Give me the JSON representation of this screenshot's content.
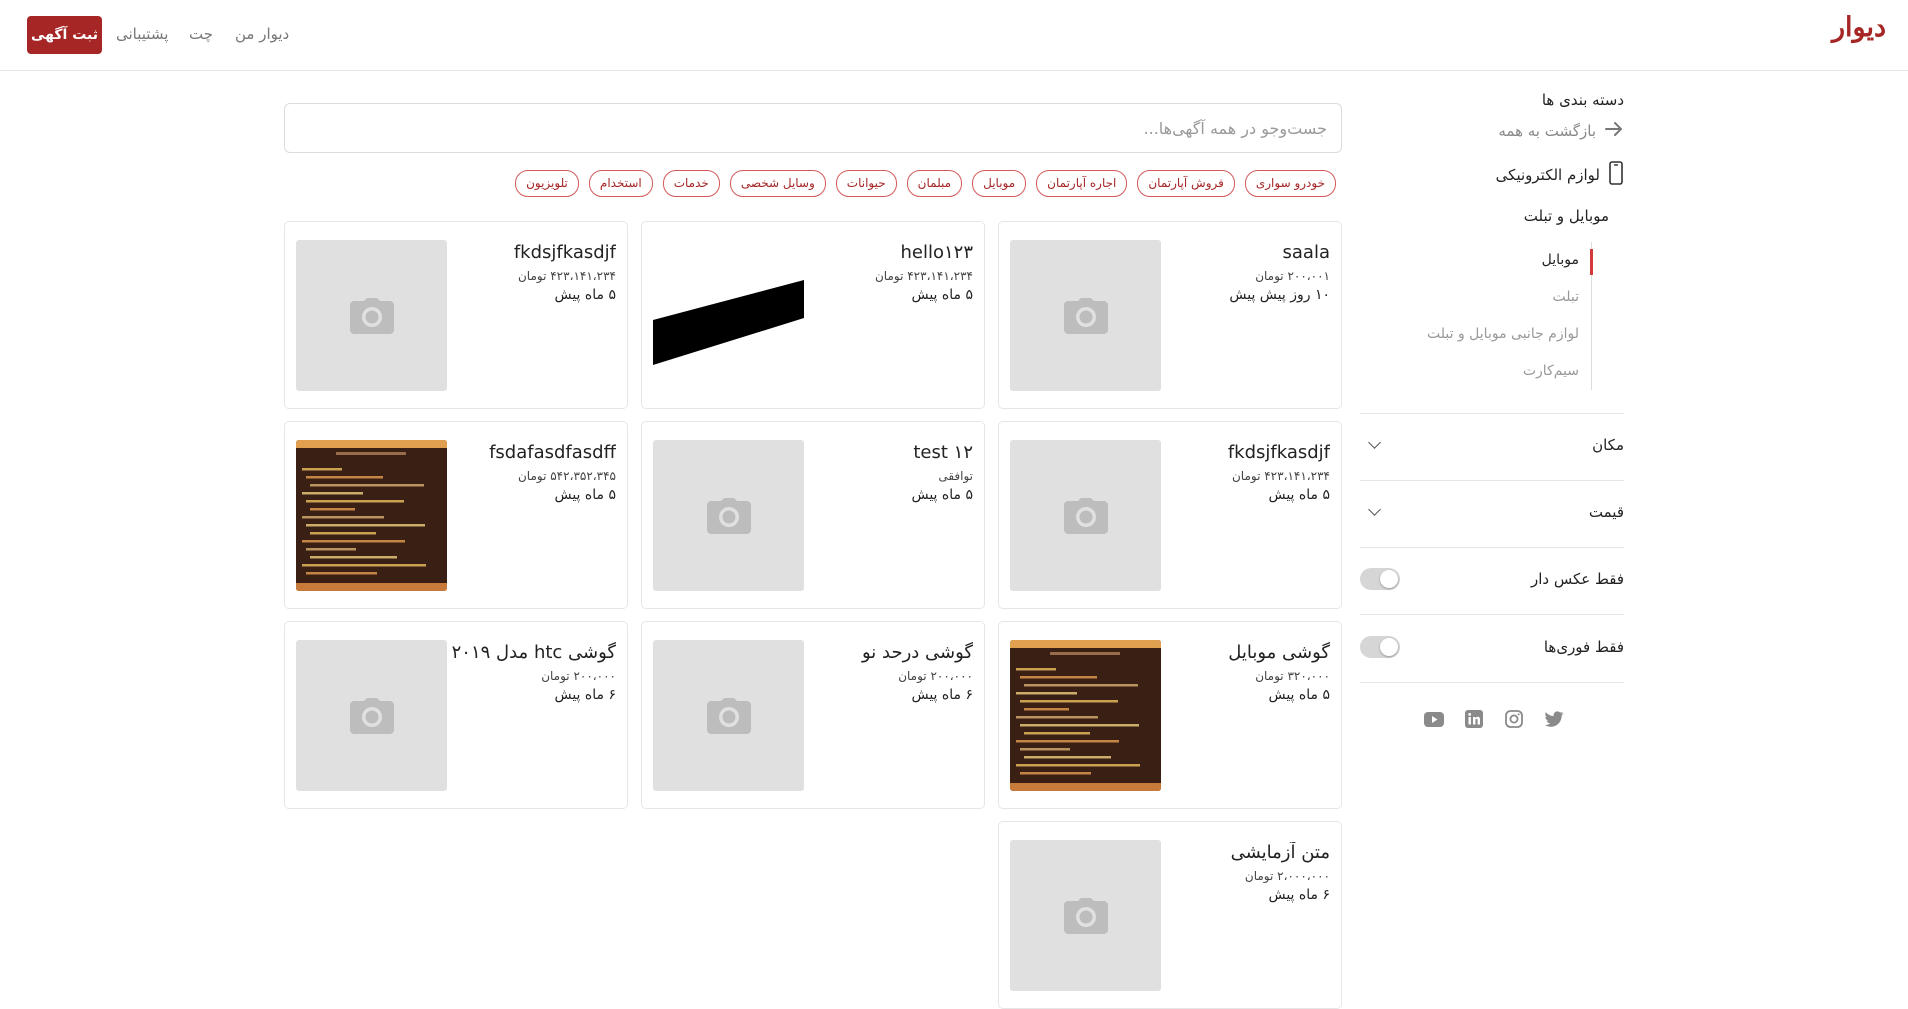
{
  "header": {
    "logo": "دیوار",
    "post_ad": "ثبت آگهی",
    "nav": {
      "my_divar": "دیوار من",
      "chat": "چت",
      "support": "پشتیبانی"
    }
  },
  "sidebar": {
    "categories_title": "دسته بندی ها",
    "back_to_all": "بازگشت به همه",
    "category": "لوازم الکترونیکی",
    "subcategory": "موبایل و تبلت",
    "sub_items": [
      {
        "label": "موبایل",
        "active": true
      },
      {
        "label": "تبلت",
        "active": false
      },
      {
        "label": "لوازم جانبی موبایل و تبلت",
        "active": false
      },
      {
        "label": "سیم‌کارت",
        "active": false
      }
    ],
    "location": "مکان",
    "price": "قیمت",
    "photo_only": "فقط عکس دار",
    "urgent_only": "فقط فوری‌ها",
    "social_icons": [
      "twitter-icon",
      "instagram-icon",
      "linkedin-icon",
      "youtube-icon"
    ]
  },
  "search": {
    "placeholder": "جست‌وجو در همه آگهی‌ها...",
    "value": ""
  },
  "chips": [
    "خودرو سواری",
    "فروش آپارتمان",
    "اجاره آپارتمان",
    "موبایل",
    "مبلمان",
    "حیوانات",
    "وسایل شخصی",
    "خدمات",
    "استخدام",
    "تلویزیون"
  ],
  "listings": [
    {
      "title": "saala",
      "price": "۲۰۰،۰۰۱ تومان",
      "time": "۱۰ روز پیش پیش",
      "image": "placeholder"
    },
    {
      "title": "hello۱۲۳",
      "price": "۴۲۳،۱۴۱،۲۳۴ تومان",
      "time": "۵ ماه پیش",
      "image": "shape"
    },
    {
      "title": "fkdsjfkasdjf",
      "price": "۴۲۳،۱۴۱،۲۳۴ تومان",
      "time": "۵ ماه پیش",
      "image": "placeholder"
    },
    {
      "title": "fkdsjfkasdjf",
      "price": "۴۲۳،۱۴۱،۲۳۴ تومان",
      "time": "۵ ماه پیش",
      "image": "placeholder"
    },
    {
      "title": "test ۱۲",
      "price": "توافقی",
      "time": "۵ ماه پیش",
      "image": "placeholder"
    },
    {
      "title": "fsdafasdfasdff",
      "price": "۵۴۲،۳۵۲،۳۴۵ تومان",
      "time": "۵ ماه پیش",
      "image": "code"
    },
    {
      "title": "گوشی موبایل",
      "price": "۳۲۰،۰۰۰ تومان",
      "time": "۵ ماه پیش",
      "image": "code"
    },
    {
      "title": "گوشی درحد نو",
      "price": "۲۰۰،۰۰۰ تومان",
      "time": "۶ ماه پیش",
      "image": "placeholder"
    },
    {
      "title": "گوشی htc مدل ۲۰۱۹",
      "price": "۲۰۰،۰۰۰ تومان",
      "time": "۶ ماه پیش",
      "image": "placeholder"
    },
    {
      "title": "متن آزمایشی",
      "price": "۲،۰۰۰،۰۰۰ تومان",
      "time": "۶ ماه پیش",
      "image": "placeholder"
    }
  ],
  "colors": {
    "brand": "#a62626",
    "chip_border": "#d45a5a",
    "active_bar": "#d43a3a"
  }
}
